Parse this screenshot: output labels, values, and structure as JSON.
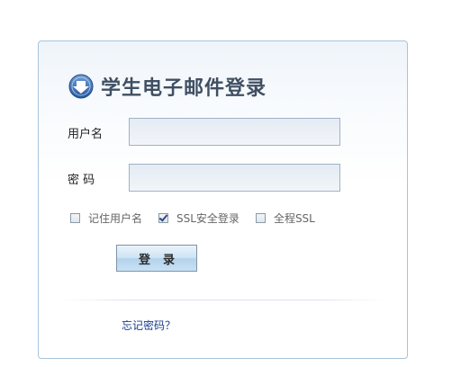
{
  "login": {
    "title": "学生电子邮件登录",
    "username_label": "用户名",
    "username_value": "",
    "password_label": "密 码",
    "password_value": "",
    "options": [
      {
        "label": "记住用户名",
        "checked": false
      },
      {
        "label": "SSL安全登录",
        "checked": true
      },
      {
        "label": "全程SSL",
        "checked": false
      }
    ],
    "submit_label": "登录",
    "forgot_link": "忘记密码？"
  },
  "colors": {
    "title_text": "#3f4f63",
    "panel_border": "#a8c4dd",
    "link": "#1a3d8f",
    "icon_blue": "#3a6fb6"
  },
  "icons": {
    "title_icon": "arrow-down-circle-icon"
  }
}
